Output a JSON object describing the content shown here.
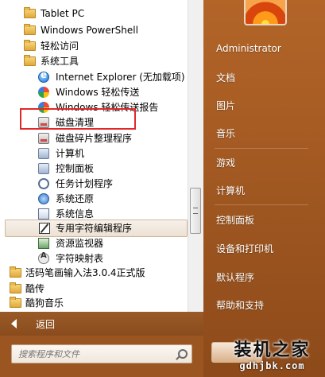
{
  "programs": [
    {
      "label": "Tablet PC",
      "icon": "folder-icon",
      "indent": 0
    },
    {
      "label": "Windows PowerShell",
      "icon": "folder-icon",
      "indent": 0
    },
    {
      "label": "轻松访问",
      "icon": "folder-icon",
      "indent": 0
    },
    {
      "label": "系统工具",
      "icon": "folder-icon",
      "indent": 0
    },
    {
      "label": "Internet Explorer (无加载项)",
      "icon": "internet-explorer-icon",
      "indent": 1
    },
    {
      "label": "Windows 轻松传送",
      "icon": "easy-transfer-icon",
      "indent": 1
    },
    {
      "label": "Windows 轻松传送报告",
      "icon": "easy-transfer-report-icon",
      "indent": 1
    },
    {
      "label": "磁盘清理",
      "icon": "disk-cleanup-icon",
      "indent": 1
    },
    {
      "label": "磁盘碎片整理程序",
      "icon": "disk-defragmenter-icon",
      "indent": 1
    },
    {
      "label": "计算机",
      "icon": "computer-icon",
      "indent": 1
    },
    {
      "label": "控制面板",
      "icon": "control-panel-icon",
      "indent": 1
    },
    {
      "label": "任务计划程序",
      "icon": "task-scheduler-icon",
      "indent": 1
    },
    {
      "label": "系统还原",
      "icon": "system-restore-icon",
      "indent": 1
    },
    {
      "label": "系统信息",
      "icon": "system-info-icon",
      "indent": 1
    },
    {
      "label": "专用字符编辑程序",
      "icon": "private-character-editor-icon",
      "indent": 1
    },
    {
      "label": "资源监视器",
      "icon": "resource-monitor-icon",
      "indent": 1
    },
    {
      "label": "字符映射表",
      "icon": "character-map-icon",
      "indent": 1
    },
    {
      "label": "活码笔画输入法3.0.4正式版",
      "icon": "folder-icon",
      "indent": 0
    },
    {
      "label": "酷传",
      "icon": "folder-icon",
      "indent": 0
    },
    {
      "label": "酷狗音乐",
      "icon": "folder-icon",
      "indent": 0
    }
  ],
  "back_label": "返回",
  "search_placeholder": "搜索程序和文件",
  "right_items": [
    {
      "label": "Administrator"
    },
    {
      "label": "文档"
    },
    {
      "label": "图片"
    },
    {
      "label": "音乐"
    },
    {
      "label": "游戏"
    },
    {
      "label": "计算机"
    },
    {
      "label": "控制面板"
    },
    {
      "label": "设备和打印机"
    },
    {
      "label": "默认程序"
    },
    {
      "label": "帮助和支持"
    }
  ],
  "watermark": {
    "title": "装机之家",
    "url": "gdhjbk.com"
  },
  "colors": {
    "highlight_box": "#e0282a",
    "pane_accent": "#9a5520"
  }
}
